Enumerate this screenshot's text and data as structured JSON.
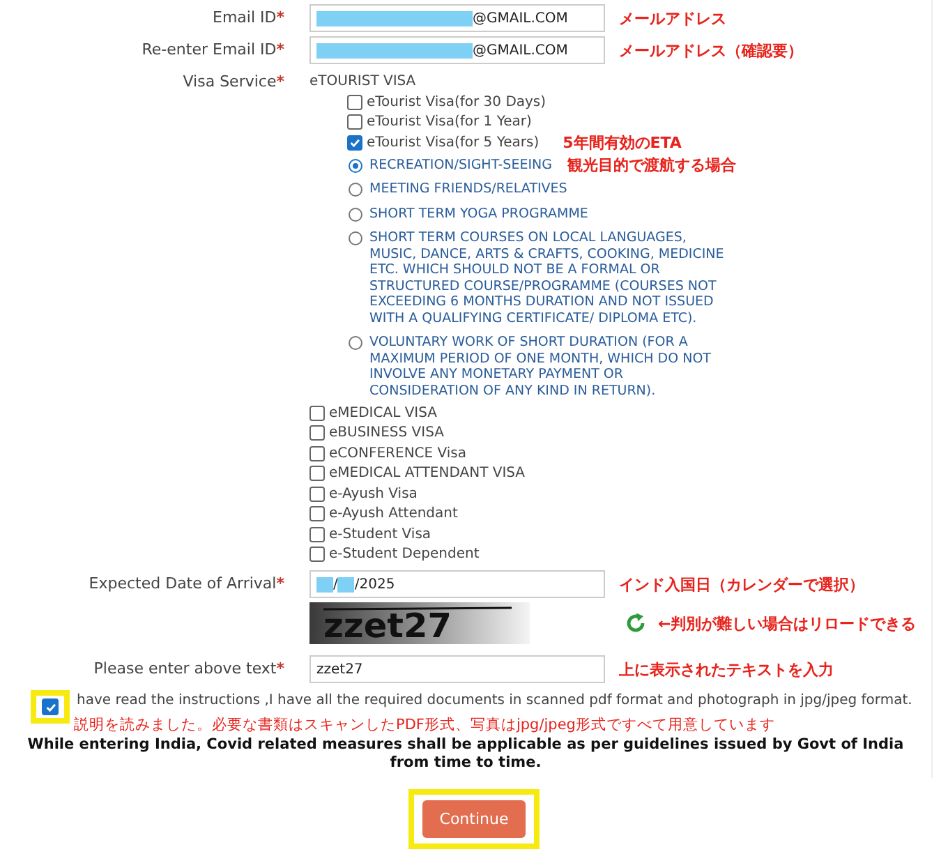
{
  "email": {
    "label": "Email ID",
    "marker": "*",
    "value": "@GMAIL.COM",
    "masked": true,
    "note": "メールアドレス"
  },
  "email_confirm": {
    "label": "Re-enter Email ID",
    "marker": "*",
    "value": "@GMAIL.COM",
    "masked": true,
    "note": "メールアドレス（確認要）"
  },
  "visa_service": {
    "label": "Visa Service",
    "marker": "*",
    "group_title": "eTOURIST VISA",
    "tourist_options": [
      {
        "label": "eTourist Visa(for 30 Days)",
        "checked": false
      },
      {
        "label": "eTourist Visa(for 1 Year)",
        "checked": false
      },
      {
        "label": "eTourist Visa(for 5 Years)",
        "checked": true,
        "note": "5年間有効のETA"
      }
    ],
    "purposes": [
      {
        "label": "RECREATION/SIGHT-SEEING",
        "selected": true,
        "note": "観光目的で渡航する場合"
      },
      {
        "label": "MEETING FRIENDS/RELATIVES",
        "selected": false
      },
      {
        "label": "SHORT TERM YOGA PROGRAMME",
        "selected": false
      },
      {
        "label": "SHORT TERM COURSES ON LOCAL LANGUAGES, MUSIC, DANCE, ARTS & CRAFTS, COOKING, MEDICINE ETC. WHICH SHOULD NOT BE A FORMAL OR STRUCTURED COURSE/PROGRAMME (COURSES NOT EXCEEDING 6 MONTHS DURATION AND NOT ISSUED WITH A QUALIFYING CERTIFICATE/ DIPLOMA ETC).",
        "selected": false
      },
      {
        "label": "VOLUNTARY WORK OF SHORT DURATION (FOR A MAXIMUM PERIOD OF ONE MONTH, WHICH DO NOT INVOLVE ANY MONETARY PAYMENT OR CONSIDERATION OF ANY KIND IN RETURN).",
        "selected": false
      }
    ],
    "other_visas": [
      {
        "label": "eMEDICAL VISA",
        "checked": false
      },
      {
        "label": "eBUSINESS VISA",
        "checked": false
      },
      {
        "label": "eCONFERENCE Visa",
        "checked": false
      },
      {
        "label": "eMEDICAL ATTENDANT VISA",
        "checked": false
      },
      {
        "label": "e-Ayush Visa",
        "checked": false
      },
      {
        "label": "e-Ayush Attendant",
        "checked": false
      },
      {
        "label": "e-Student Visa",
        "checked": false
      },
      {
        "label": "e-Student Dependent",
        "checked": false
      }
    ]
  },
  "arrival_date": {
    "label": "Expected Date of Arrival",
    "marker": "*",
    "value_parts": [
      "/",
      "/2025"
    ],
    "masked": true,
    "note": "インド入国日（カレンダーで選択）"
  },
  "captcha": {
    "text": "zzet27",
    "note": "←判別が難しい場合はリロードできる"
  },
  "captcha_answer": {
    "label": "Please enter above text",
    "marker": "*",
    "value": "zzet27",
    "note": "上に表示されたテキストを入力"
  },
  "agreement": {
    "checked": true,
    "highlighted": true,
    "text": "have read the instructions ,I have all the required documents in scanned pdf format and photograph in jpg/jpeg format.",
    "note": "説明を読みました。必要な書類はスキャンしたPDF形式、写真はjpg/jpeg形式ですべて用意しています"
  },
  "notice": "While entering India, Covid related measures shall be applicable as per guidelines issued by Govt of India from time to time.",
  "continue_button": {
    "label": "Continue",
    "highlighted": true
  }
}
